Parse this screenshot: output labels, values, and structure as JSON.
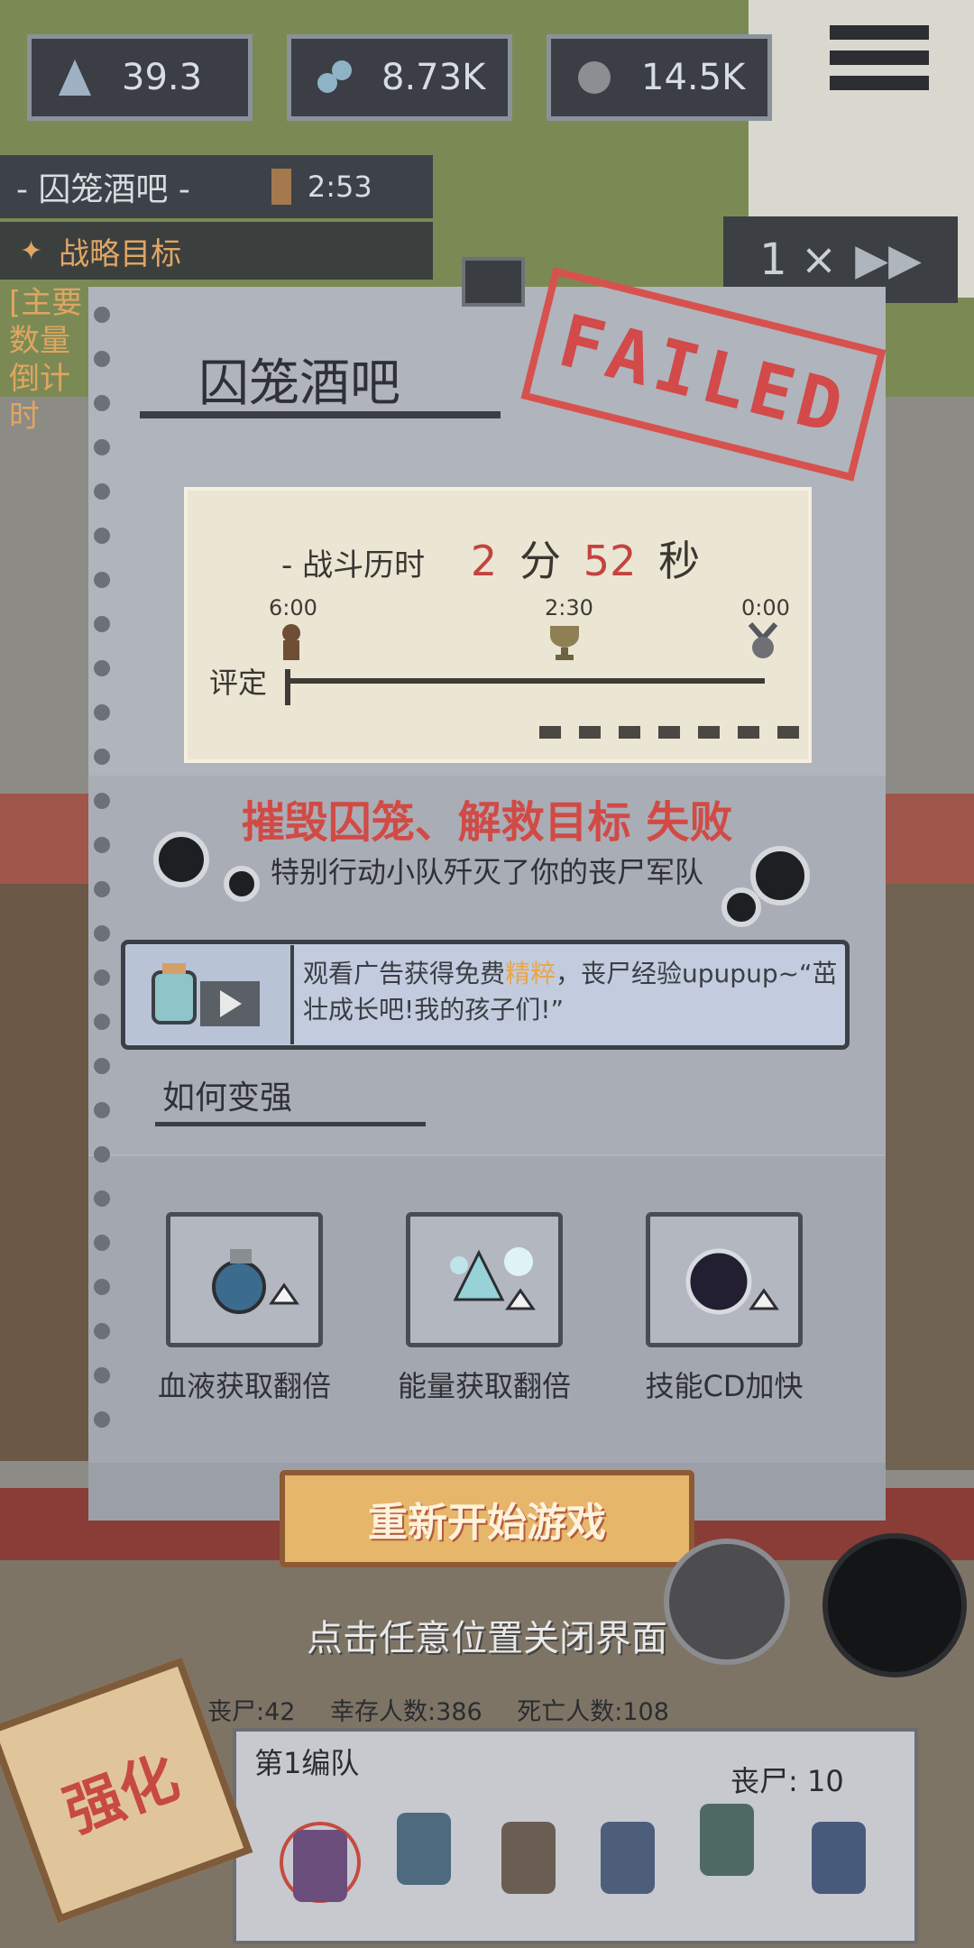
{
  "hud": {
    "energy": "39.3",
    "crystals": "8.73K",
    "blood": "14.5K",
    "stage_label": "- 囚笼酒吧 -",
    "timer": "2:53",
    "strategy_label": "战略目标",
    "side_text": [
      "[主要",
      "数量",
      "倒计时"
    ],
    "speed": "1 ×"
  },
  "dialog": {
    "title": "囚笼酒吧",
    "stamp": "FAILED",
    "duration_label": "- 战斗历时",
    "duration_min": "2",
    "duration_min_unit": "分",
    "duration_sec": "52",
    "duration_sec_unit": "秒",
    "rating_label": "评定",
    "ticks": [
      "6:00",
      "2:30",
      "0:00"
    ],
    "fail_title": "摧毁囚笼、解救目标 失败",
    "fail_sub": "特别行动小队歼灭了你的丧尸军队",
    "ad_text_pre": "观看广告获得免费",
    "ad_text_hl": "精粹",
    "ad_text_post": "，丧尸经验upupup~“茁壮成长吧!我的孩子们!”",
    "howto_title": "如何变强",
    "tips": [
      {
        "label": "血液获取翻倍",
        "icon": "blood-flask-icon"
      },
      {
        "label": "能量获取翻倍",
        "icon": "energy-crystal-icon"
      },
      {
        "label": "技能CD加快",
        "icon": "dark-orb-icon"
      }
    ],
    "restart_label": "重新开始游戏"
  },
  "close_hint": "点击任意位置关闭界面",
  "stats": {
    "zombies": "丧尸:42",
    "survivors": "幸存人数:386",
    "deaths": "死亡人数:108"
  },
  "squad": {
    "name": "第1编队",
    "count": "丧尸: 10"
  },
  "strengthen_label": "强化",
  "colors": {
    "fail_red": "#d24a45",
    "accent_orange": "#e1a564",
    "button_gold": "#e6b66a"
  }
}
